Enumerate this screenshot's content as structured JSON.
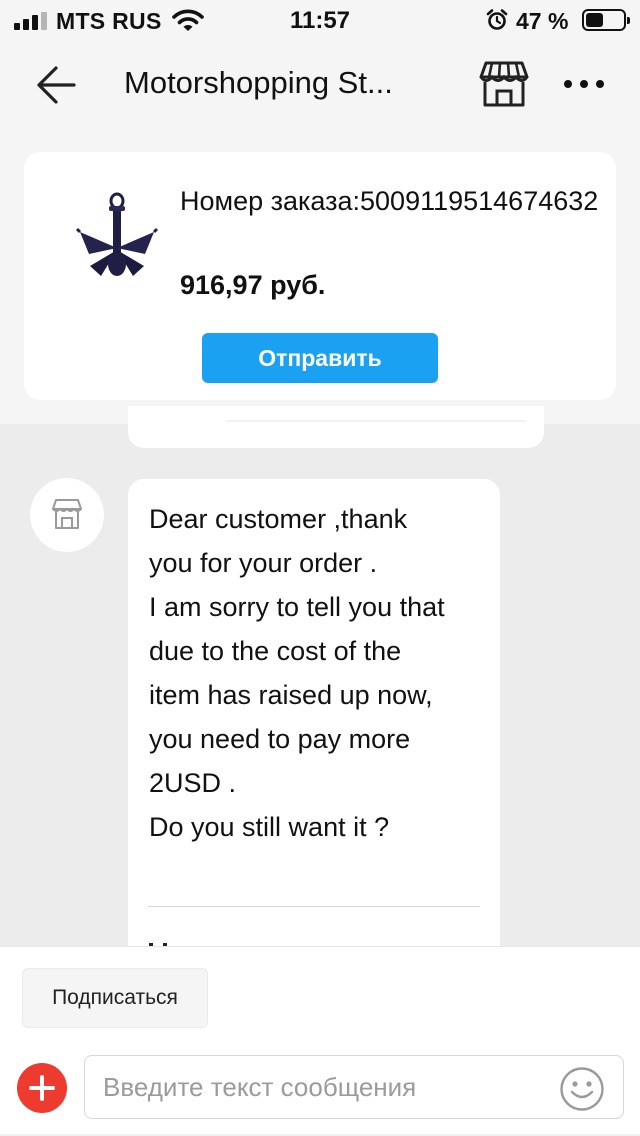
{
  "status_bar": {
    "carrier": "MTS RUS",
    "time": "11:57",
    "battery": "47 %",
    "battery_level": 0.47,
    "icons": [
      "signal-icon",
      "wifi-icon",
      "alarm-icon",
      "battery-icon"
    ]
  },
  "nav": {
    "title": "Motorshopping St...",
    "icons": [
      "back-arrow-icon",
      "store-icon",
      "more-icon"
    ]
  },
  "order": {
    "number_label": "Номер заказа:5009119514674632",
    "price": "916,97 руб.",
    "send_label": "Отправить",
    "image": "anchor-product-image"
  },
  "chat": {
    "message": "Dear customer ,thank\nyou for your order .\nI am sorry to tell you that\ndue to the cost of the\nitem has raised up now,\nyou need to pay more\n2USD .\nDo you still want it ?",
    "avatar_icon": "store-icon"
  },
  "bottom": {
    "subscribe_label": "Подписаться",
    "input_placeholder": "Введите текст сообщения",
    "input_value": "",
    "icons": [
      "plus-icon",
      "emoji-icon"
    ]
  },
  "colors": {
    "accent": "#1aa1f2",
    "add_button": "#ee3b30",
    "background": "#ececec"
  }
}
